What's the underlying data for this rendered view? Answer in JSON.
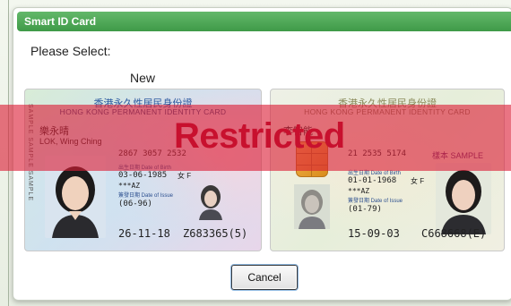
{
  "dialog": {
    "title": "Smart ID Card",
    "prompt": "Please Select:",
    "new_label": "New",
    "cancel_label": "Cancel"
  },
  "overlay": {
    "text": "Restricted",
    "color": "#c8102e"
  },
  "cards": {
    "new": {
      "title_zh": "香港永久性居民身份證",
      "title_en": "HONG KONG PERMANENT IDENTITY CARD",
      "side_text": "SAMPLE SAMPLE SAMPLE",
      "name_zh": "樂永晴",
      "name_en": "LOK, Wing Ching",
      "code": "2867 3057 2532",
      "dob_label": "出生日期 Date of Birth",
      "dob": "03-06-1985",
      "sex": "女 F",
      "symbols": "***AZ",
      "issue_label": "簽發日期 Date of Issue",
      "issue_code": "(06-96)",
      "issue_date": "26-11-18",
      "id_number": "Z683365(5)"
    },
    "old": {
      "title_zh": "香港永久性居民身份證",
      "title_en": "HONG KONG PERMANENT IDENTITY CARD",
      "name_zh": "李智能",
      "code": "21 2535 5174",
      "sample_label": "樣本 SAMPLE",
      "dob_label": "出生日期 Date of Birth",
      "dob": "01-01-1968",
      "sex": "女 F",
      "symbols": "***AZ",
      "issue_label": "簽發日期 Date of Issue",
      "issue_code": "(01-79)",
      "issue_date": "15-09-03",
      "id_number": "C668668(E)"
    }
  }
}
